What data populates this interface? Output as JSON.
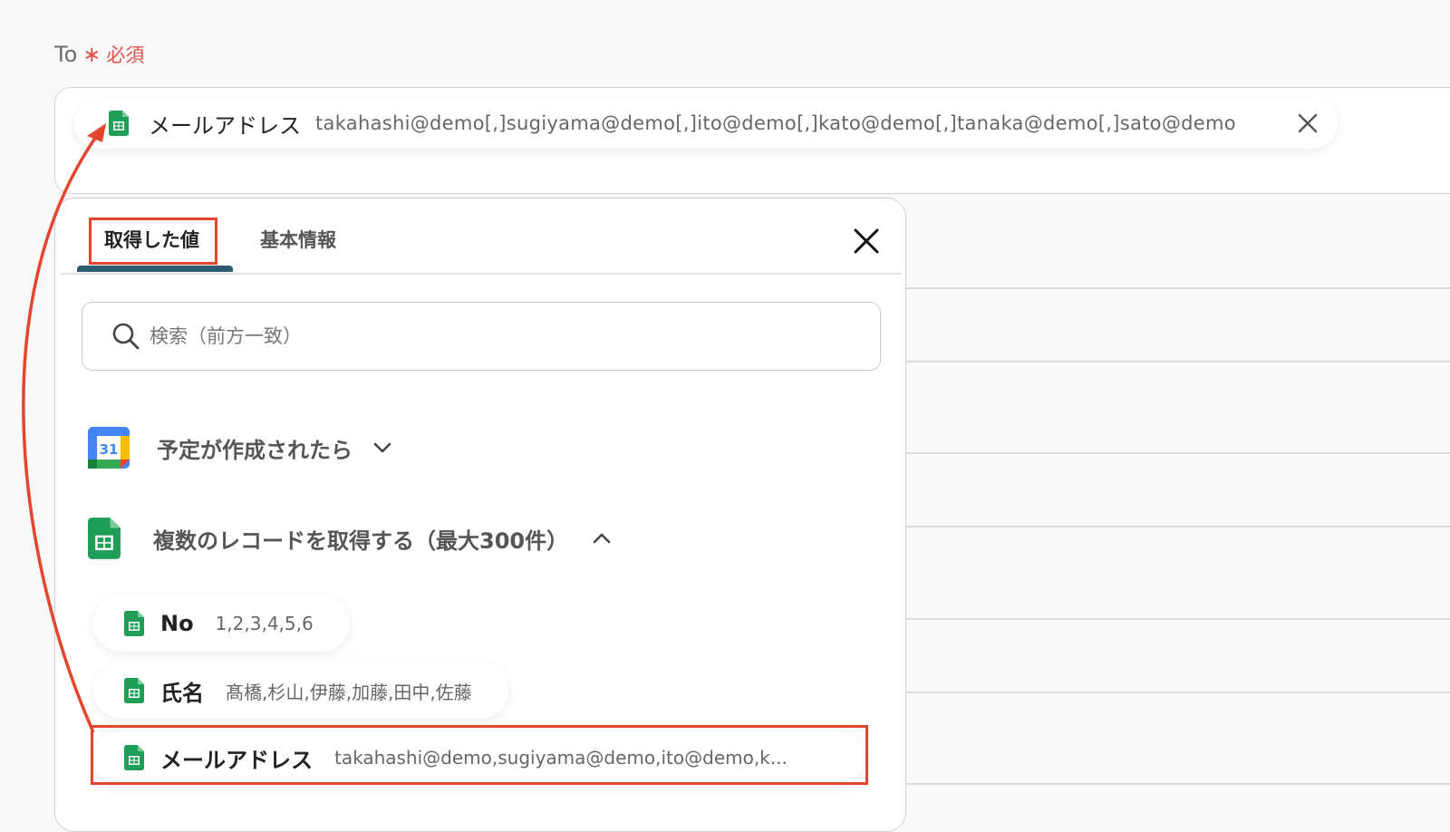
{
  "field": {
    "label": "To",
    "required_star": "∗",
    "required_text": "必須"
  },
  "selected_chip": {
    "icon": "google-sheets-icon",
    "name": "メールアドレス",
    "value": "takahashi@demo[,]sugiyama@demo[,]ito@demo[,]kato@demo[,]tanaka@demo[,]sato@demo"
  },
  "panel": {
    "tabs": [
      "取得した値",
      "基本情報"
    ],
    "active_tab": 0,
    "search": {
      "placeholder": "検索（前方一致）",
      "value": ""
    },
    "sections": [
      {
        "icon": "google-calendar-icon",
        "title": "予定が作成されたら",
        "expanded": false
      },
      {
        "icon": "google-sheets-icon",
        "title": "複数のレコードを取得する（最大300件）",
        "expanded": true
      }
    ],
    "items": [
      {
        "icon": "google-sheets-icon",
        "name": "No",
        "value": "1,2,3,4,5,6"
      },
      {
        "icon": "google-sheets-icon",
        "name": "氏名",
        "value": "髙橋,杉山,伊藤,加藤,田中,佐藤"
      },
      {
        "icon": "google-sheets-icon",
        "name": "メールアドレス",
        "value": "takahashi@demo,sugiyama@demo,ito@demo,k..."
      }
    ]
  },
  "colors": {
    "highlight": "#e5452e",
    "tab_underline": "#2c5b72",
    "required": "#e0524a",
    "sheets_green": "#1e9e56"
  }
}
